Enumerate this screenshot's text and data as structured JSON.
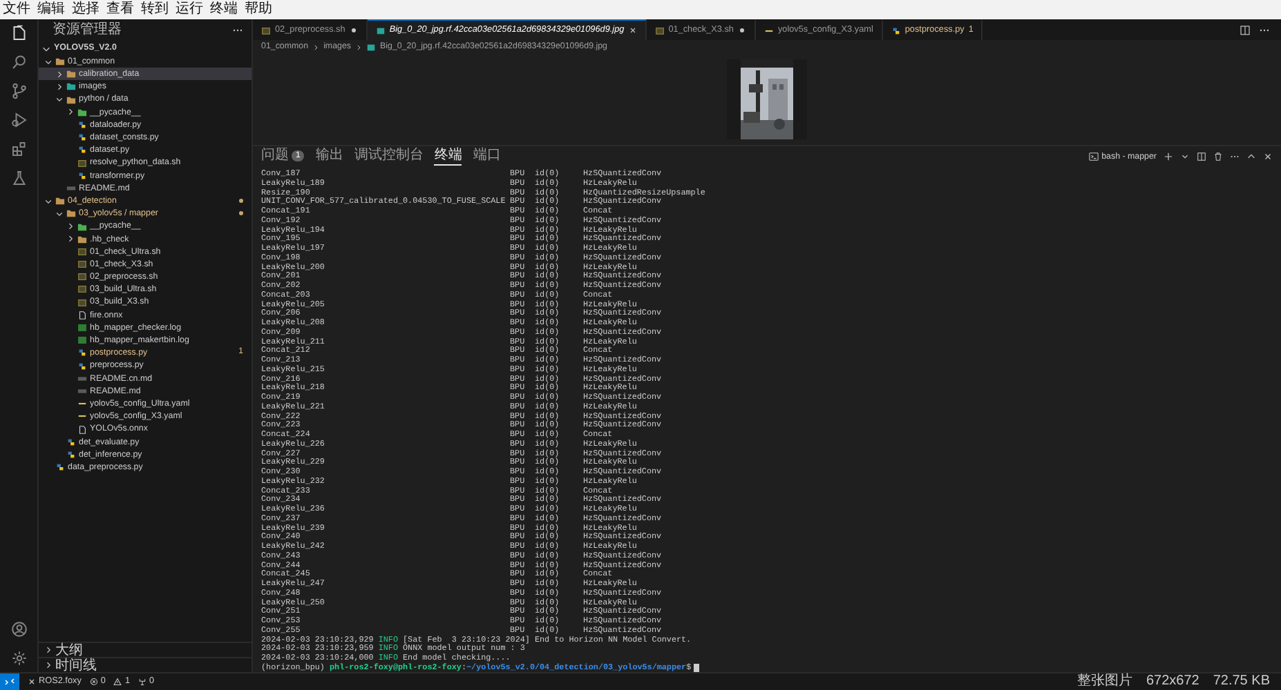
{
  "menu": [
    "文件",
    "编辑",
    "选择",
    "查看",
    "转到",
    "运行",
    "终端",
    "帮助"
  ],
  "sidebar": {
    "title": "资源管理器",
    "root": {
      "name": "YOLOV5S_V2.0",
      "expanded": true
    },
    "tree": [
      {
        "name": "01_common",
        "kind": "folder",
        "expanded": true,
        "selected": false,
        "modified": false,
        "children": [
          {
            "name": "calibration_data",
            "kind": "folder",
            "expanded": false,
            "selected": true,
            "modified": false
          },
          {
            "name": "images",
            "kind": "image-folder",
            "expanded": false,
            "selected": false,
            "modified": false
          },
          {
            "name": "python / data",
            "kind": "folder",
            "expanded": true,
            "selected": false,
            "modified": false,
            "children": [
              {
                "name": "__pycache__",
                "kind": "cache-folder",
                "expanded": false,
                "selected": false,
                "modified": false
              },
              {
                "name": "dataloader.py",
                "kind": "python",
                "selected": false,
                "modified": false
              },
              {
                "name": "dataset_consts.py",
                "kind": "python",
                "selected": false,
                "modified": false
              },
              {
                "name": "dataset.py",
                "kind": "python",
                "selected": false,
                "modified": false
              },
              {
                "name": "resolve_python_data.sh",
                "kind": "shell",
                "selected": false,
                "modified": false
              },
              {
                "name": "transformer.py",
                "kind": "python",
                "selected": false,
                "modified": false
              }
            ]
          },
          {
            "name": "README.md",
            "kind": "markdown",
            "selected": false,
            "modified": false
          }
        ]
      },
      {
        "name": "04_detection",
        "kind": "folder",
        "expanded": true,
        "selected": false,
        "modified": true,
        "children": [
          {
            "name": "03_yolov5s / mapper",
            "kind": "folder",
            "expanded": true,
            "selected": false,
            "modified": true,
            "children": [
              {
                "name": "__pycache__",
                "kind": "cache-folder",
                "expanded": false,
                "selected": false,
                "modified": false
              },
              {
                "name": ".hb_check",
                "kind": "folder",
                "expanded": false,
                "selected": false,
                "modified": false
              },
              {
                "name": "01_check_Ultra.sh",
                "kind": "shell",
                "selected": false,
                "modified": false
              },
              {
                "name": "01_check_X3.sh",
                "kind": "shell",
                "selected": false,
                "modified": false
              },
              {
                "name": "02_preprocess.sh",
                "kind": "shell",
                "selected": false,
                "modified": false
              },
              {
                "name": "03_build_Ultra.sh",
                "kind": "shell",
                "selected": false,
                "modified": false
              },
              {
                "name": "03_build_X3.sh",
                "kind": "shell",
                "selected": false,
                "modified": false
              },
              {
                "name": "fire.onnx",
                "kind": "onnx",
                "selected": false,
                "modified": false
              },
              {
                "name": "hb_mapper_checker.log",
                "kind": "log",
                "selected": false,
                "modified": false
              },
              {
                "name": "hb_mapper_makertbin.log",
                "kind": "log",
                "selected": false,
                "modified": false
              },
              {
                "name": "postprocess.py",
                "kind": "python",
                "selected": false,
                "modified": true,
                "badge": "1"
              },
              {
                "name": "preprocess.py",
                "kind": "python",
                "selected": false,
                "modified": false
              },
              {
                "name": "README.cn.md",
                "kind": "markdown",
                "selected": false,
                "modified": false
              },
              {
                "name": "README.md",
                "kind": "markdown",
                "selected": false,
                "modified": false
              },
              {
                "name": "yolov5s_config_Ultra.yaml",
                "kind": "yaml",
                "selected": false,
                "modified": false
              },
              {
                "name": "yolov5s_config_X3.yaml",
                "kind": "yaml",
                "selected": false,
                "modified": false
              },
              {
                "name": "YOLOv5s.onnx",
                "kind": "onnx",
                "selected": false,
                "modified": false
              }
            ]
          },
          {
            "name": "det_evaluate.py",
            "kind": "python",
            "selected": false,
            "modified": false
          },
          {
            "name": "det_inference.py",
            "kind": "python",
            "selected": false,
            "modified": false
          }
        ]
      },
      {
        "name": "data_preprocess.py",
        "kind": "python",
        "selected": false,
        "modified": false
      }
    ],
    "sections": [
      {
        "label": "大纲",
        "expanded": false
      },
      {
        "label": "时间线",
        "expanded": false
      }
    ]
  },
  "tabs": [
    {
      "label": "02_preprocess.sh",
      "kind": "shell",
      "selected": false,
      "dirty": true,
      "preview": false,
      "modified": false
    },
    {
      "label": "Big_0_20_jpg.rf.42cca03e02561a2d69834329e01096d9.jpg",
      "selected": true,
      "dirty": false,
      "preview": true,
      "modified": false
    },
    {
      "label": "01_check_X3.sh",
      "kind": "shell",
      "selected": false,
      "dirty": true,
      "preview": false,
      "modified": false
    },
    {
      "label": "yolov5s_config_X3.yaml",
      "kind": "yaml",
      "selected": false,
      "dirty": false,
      "preview": false,
      "modified": false
    },
    {
      "label": "postprocess.py",
      "kind": "python",
      "selected": false,
      "dirty": false,
      "preview": false,
      "modified": true,
      "badge": "1"
    }
  ],
  "breadcrumb": [
    "01_common",
    "images",
    "Big_0_20_jpg.rf.42cca03e02561a2d69834329e01096d9.jpg"
  ],
  "editor": {
    "kind": "picture"
  },
  "panel": {
    "tabs": [
      {
        "label": "问题",
        "badge": "1",
        "selected": false
      },
      {
        "label": "输出",
        "selected": false
      },
      {
        "label": "调试控制台",
        "selected": false
      },
      {
        "label": "终端",
        "selected": true
      },
      {
        "label": "端口",
        "selected": false
      }
    ],
    "terminal_name": "bash - mapper",
    "lines": [
      {
        "kind": "op",
        "name": "Conv_187",
        "unit": "BPU",
        "id": "id(0)",
        "type": "HzSQuantizedConv"
      },
      {
        "kind": "op",
        "name": "LeakyRelu_189",
        "unit": "BPU",
        "id": "id(0)",
        "type": "HzLeakyRelu"
      },
      {
        "kind": "op",
        "name": "Resize_190",
        "unit": "BPU",
        "id": "id(0)",
        "type": "HzQuantizedResizeUpsample"
      },
      {
        "kind": "op",
        "name": "UNIT_CONV_FOR_577_calibrated_0.04530_TO_FUSE_SCALE",
        "unit": "BPU",
        "id": "id(0)",
        "type": "HzSQuantizedConv"
      },
      {
        "kind": "op",
        "name": "Concat_191",
        "unit": "BPU",
        "id": "id(0)",
        "type": "Concat"
      },
      {
        "kind": "op",
        "name": "Conv_192",
        "unit": "BPU",
        "id": "id(0)",
        "type": "HzSQuantizedConv"
      },
      {
        "kind": "op",
        "name": "LeakyRelu_194",
        "unit": "BPU",
        "id": "id(0)",
        "type": "HzLeakyRelu"
      },
      {
        "kind": "op",
        "name": "Conv_195",
        "unit": "BPU",
        "id": "id(0)",
        "type": "HzSQuantizedConv"
      },
      {
        "kind": "op",
        "name": "LeakyRelu_197",
        "unit": "BPU",
        "id": "id(0)",
        "type": "HzLeakyRelu"
      },
      {
        "kind": "op",
        "name": "Conv_198",
        "unit": "BPU",
        "id": "id(0)",
        "type": "HzSQuantizedConv"
      },
      {
        "kind": "op",
        "name": "LeakyRelu_200",
        "unit": "BPU",
        "id": "id(0)",
        "type": "HzLeakyRelu"
      },
      {
        "kind": "op",
        "name": "Conv_201",
        "unit": "BPU",
        "id": "id(0)",
        "type": "HzSQuantizedConv"
      },
      {
        "kind": "op",
        "name": "Conv_202",
        "unit": "BPU",
        "id": "id(0)",
        "type": "HzSQuantizedConv"
      },
      {
        "kind": "op",
        "name": "Concat_203",
        "unit": "BPU",
        "id": "id(0)",
        "type": "Concat"
      },
      {
        "kind": "op",
        "name": "LeakyRelu_205",
        "unit": "BPU",
        "id": "id(0)",
        "type": "HzLeakyRelu"
      },
      {
        "kind": "op",
        "name": "Conv_206",
        "unit": "BPU",
        "id": "id(0)",
        "type": "HzSQuantizedConv"
      },
      {
        "kind": "op",
        "name": "LeakyRelu_208",
        "unit": "BPU",
        "id": "id(0)",
        "type": "HzLeakyRelu"
      },
      {
        "kind": "op",
        "name": "Conv_209",
        "unit": "BPU",
        "id": "id(0)",
        "type": "HzSQuantizedConv"
      },
      {
        "kind": "op",
        "name": "LeakyRelu_211",
        "unit": "BPU",
        "id": "id(0)",
        "type": "HzLeakyRelu"
      },
      {
        "kind": "op",
        "name": "Concat_212",
        "unit": "BPU",
        "id": "id(0)",
        "type": "Concat"
      },
      {
        "kind": "op",
        "name": "Conv_213",
        "unit": "BPU",
        "id": "id(0)",
        "type": "HzSQuantizedConv"
      },
      {
        "kind": "op",
        "name": "LeakyRelu_215",
        "unit": "BPU",
        "id": "id(0)",
        "type": "HzLeakyRelu"
      },
      {
        "kind": "op",
        "name": "Conv_216",
        "unit": "BPU",
        "id": "id(0)",
        "type": "HzSQuantizedConv"
      },
      {
        "kind": "op",
        "name": "LeakyRelu_218",
        "unit": "BPU",
        "id": "id(0)",
        "type": "HzLeakyRelu"
      },
      {
        "kind": "op",
        "name": "Conv_219",
        "unit": "BPU",
        "id": "id(0)",
        "type": "HzSQuantizedConv"
      },
      {
        "kind": "op",
        "name": "LeakyRelu_221",
        "unit": "BPU",
        "id": "id(0)",
        "type": "HzLeakyRelu"
      },
      {
        "kind": "op",
        "name": "Conv_222",
        "unit": "BPU",
        "id": "id(0)",
        "type": "HzSQuantizedConv"
      },
      {
        "kind": "op",
        "name": "Conv_223",
        "unit": "BPU",
        "id": "id(0)",
        "type": "HzSQuantizedConv"
      },
      {
        "kind": "op",
        "name": "Concat_224",
        "unit": "BPU",
        "id": "id(0)",
        "type": "Concat"
      },
      {
        "kind": "op",
        "name": "LeakyRelu_226",
        "unit": "BPU",
        "id": "id(0)",
        "type": "HzLeakyRelu"
      },
      {
        "kind": "op",
        "name": "Conv_227",
        "unit": "BPU",
        "id": "id(0)",
        "type": "HzSQuantizedConv"
      },
      {
        "kind": "op",
        "name": "LeakyRelu_229",
        "unit": "BPU",
        "id": "id(0)",
        "type": "HzLeakyRelu"
      },
      {
        "kind": "op",
        "name": "Conv_230",
        "unit": "BPU",
        "id": "id(0)",
        "type": "HzSQuantizedConv"
      },
      {
        "kind": "op",
        "name": "LeakyRelu_232",
        "unit": "BPU",
        "id": "id(0)",
        "type": "HzLeakyRelu"
      },
      {
        "kind": "op",
        "name": "Concat_233",
        "unit": "BPU",
        "id": "id(0)",
        "type": "Concat"
      },
      {
        "kind": "op",
        "name": "Conv_234",
        "unit": "BPU",
        "id": "id(0)",
        "type": "HzSQuantizedConv"
      },
      {
        "kind": "op",
        "name": "LeakyRelu_236",
        "unit": "BPU",
        "id": "id(0)",
        "type": "HzLeakyRelu"
      },
      {
        "kind": "op",
        "name": "Conv_237",
        "unit": "BPU",
        "id": "id(0)",
        "type": "HzSQuantizedConv"
      },
      {
        "kind": "op",
        "name": "LeakyRelu_239",
        "unit": "BPU",
        "id": "id(0)",
        "type": "HzLeakyRelu"
      },
      {
        "kind": "op",
        "name": "Conv_240",
        "unit": "BPU",
        "id": "id(0)",
        "type": "HzSQuantizedConv"
      },
      {
        "kind": "op",
        "name": "LeakyRelu_242",
        "unit": "BPU",
        "id": "id(0)",
        "type": "HzLeakyRelu"
      },
      {
        "kind": "op",
        "name": "Conv_243",
        "unit": "BPU",
        "id": "id(0)",
        "type": "HzSQuantizedConv"
      },
      {
        "kind": "op",
        "name": "Conv_244",
        "unit": "BPU",
        "id": "id(0)",
        "type": "HzSQuantizedConv"
      },
      {
        "kind": "op",
        "name": "Concat_245",
        "unit": "BPU",
        "id": "id(0)",
        "type": "Concat"
      },
      {
        "kind": "op",
        "name": "LeakyRelu_247",
        "unit": "BPU",
        "id": "id(0)",
        "type": "HzLeakyRelu"
      },
      {
        "kind": "op",
        "name": "Conv_248",
        "unit": "BPU",
        "id": "id(0)",
        "type": "HzSQuantizedConv"
      },
      {
        "kind": "op",
        "name": "LeakyRelu_250",
        "unit": "BPU",
        "id": "id(0)",
        "type": "HzLeakyRelu"
      },
      {
        "kind": "op",
        "name": "Conv_251",
        "unit": "BPU",
        "id": "id(0)",
        "type": "HzSQuantizedConv"
      },
      {
        "kind": "op",
        "name": "Conv_253",
        "unit": "BPU",
        "id": "id(0)",
        "type": "HzSQuantizedConv"
      },
      {
        "kind": "op",
        "name": "Conv_255",
        "unit": "BPU",
        "id": "id(0)",
        "type": "HzSQuantizedConv"
      },
      {
        "kind": "log",
        "time": "2024-02-03 23:10:23,929",
        "level": "INFO",
        "message": "[Sat Feb  3 23:10:23 2024] End to Horizon NN Model Convert."
      },
      {
        "kind": "log",
        "time": "2024-02-03 23:10:23,959",
        "level": "INFO",
        "message": "ONNX model output num : 3"
      },
      {
        "kind": "log",
        "time": "2024-02-03 23:10:24,000",
        "level": "INFO",
        "message": "End model checking...."
      },
      {
        "kind": "prompt",
        "env": "(horizon_bpu)",
        "user": "phl-ros2-foxy@phl-ros2-foxy",
        "separator": ":",
        "path": "~/yolov5s_v2.0/04_detection/03_yolov5s/mapper",
        "symbol": "$"
      }
    ]
  },
  "status_bar": {
    "left": [
      {
        "kind": "remote-name",
        "text": "ROS2.foxy"
      },
      {
        "kind": "errors",
        "text": "0"
      },
      {
        "kind": "warnings",
        "text": "1"
      },
      {
        "kind": "ports",
        "text": "0"
      }
    ],
    "right": [
      "整张图片",
      "672x672",
      "72.75 KB"
    ]
  }
}
